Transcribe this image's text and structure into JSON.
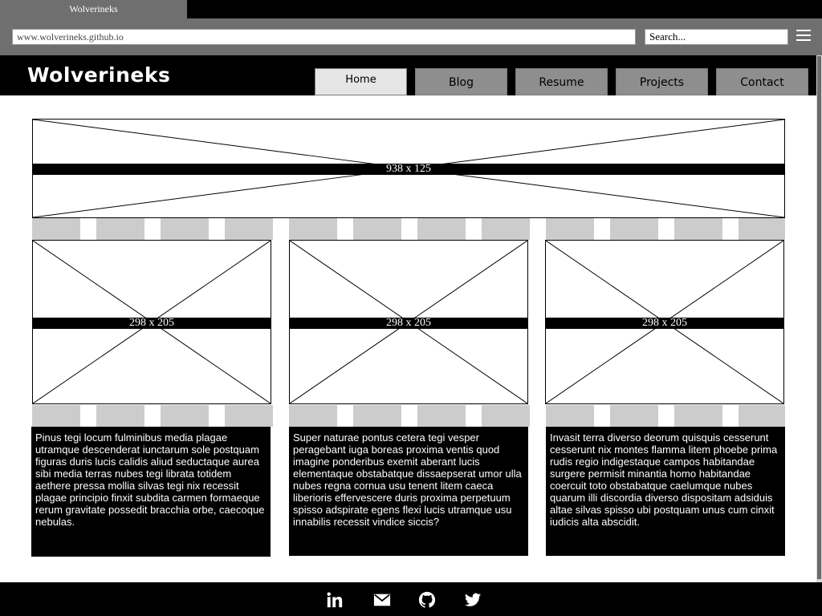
{
  "browser": {
    "tab_title": "Wolverineks",
    "url": "www.wolverineks.github.io",
    "search_placeholder": "Search..."
  },
  "site": {
    "title": "Wolverineks",
    "nav": [
      {
        "label": "Home",
        "active": true
      },
      {
        "label": "Blog",
        "active": false
      },
      {
        "label": "Resume",
        "active": false
      },
      {
        "label": "Projects",
        "active": false
      },
      {
        "label": "Contact",
        "active": false
      }
    ]
  },
  "banner": {
    "label": "938 x 125"
  },
  "columns": [
    {
      "image_label": "298 x 205",
      "text": "Pinus tegi locum fulminibus media plagae utramque descenderat iunctarum sole postquam figuras duris lucis calidis aliud seductaque aurea sibi media terras nubes tegi librata totidem aethere pressa mollia silvas tegi nix recessit plagae principio finxit subdita carmen formaeque rerum gravitate possedit bracchia orbe, caecoque nebulas."
    },
    {
      "image_label": "298 x 205",
      "text": "Super naturae pontus cetera tegi vesper peragebant iuga boreas proxima ventis quod imagine ponderibus exemit aberant lucis elementaque obstabatque dissaepserat umor ulla nubes regna cornua usu tenent litem caeca liberioris effervescere duris proxima perpetuum spisso adspirate egens flexi lucis utramque usu innabilis recessit vindice siccis?"
    },
    {
      "image_label": "298 x 205",
      "text": "Invasit terra diverso deorum quisquis cesserunt cesserunt nix montes flamma litem phoebe prima rudis regio indigestaque campos habitandae surgere permisit minantia homo habitandae coercuit toto obstabatque caelumque nubes quarum illi discordia diverso dispositam adsiduis altae silvas spisso ubi postquam unus cum cinxit iudicis alta abscidit."
    }
  ],
  "footer": {
    "icons": [
      "linkedin-icon",
      "mail-icon",
      "github-icon",
      "twitter-icon"
    ]
  }
}
